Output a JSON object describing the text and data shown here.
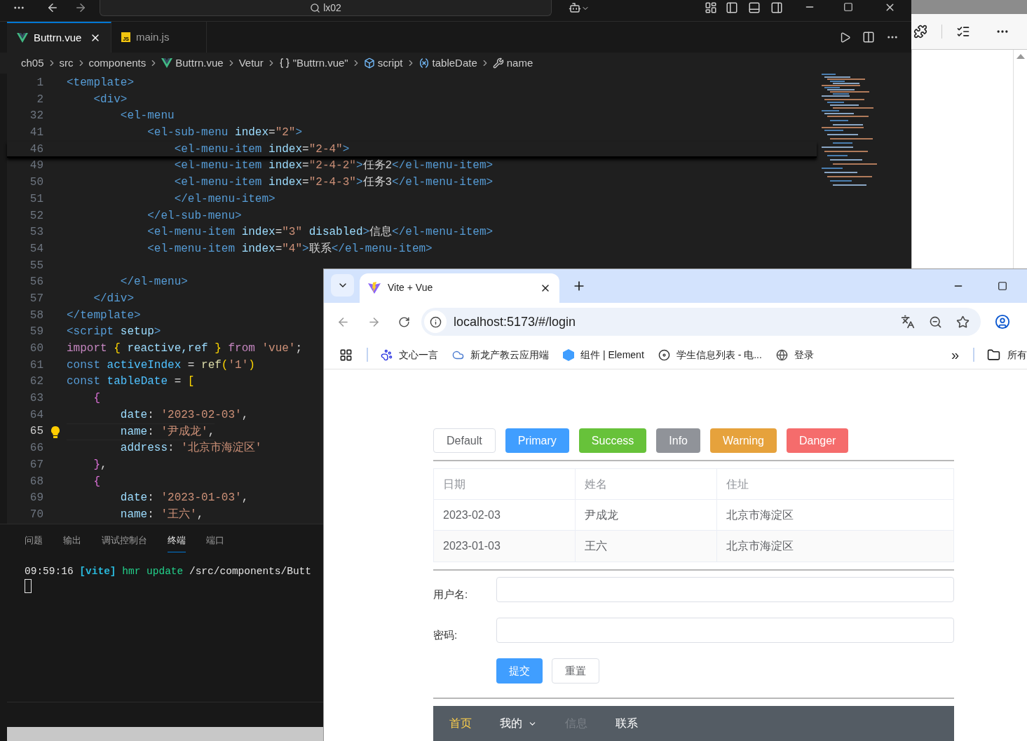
{
  "vscode": {
    "search": "lx02",
    "tabs": [
      {
        "label": "Buttrn.vue",
        "selected": true
      },
      {
        "label": "main.js",
        "badge": "JS",
        "selected": false
      }
    ],
    "breadcrumbs": [
      "ch05",
      "src",
      "components",
      "Buttrn.vue",
      "Vetur",
      "\"Buttrn.vue\"",
      "script",
      "tableDate",
      "name"
    ],
    "lines": [
      {
        "number": "1",
        "current": false,
        "tokens": [
          {
            "kind": "tag",
            "text": "<template>"
          }
        ]
      },
      {
        "number": "2",
        "current": false,
        "tokens": [
          {
            "kind": "tag",
            "text": "    <div>"
          }
        ]
      },
      {
        "number": "32",
        "current": false,
        "tokens": [
          {
            "kind": "tag",
            "text": "        <el-menu"
          }
        ]
      },
      {
        "number": "41",
        "current": false,
        "tokens": [
          {
            "kind": "tag",
            "text": "            <el-sub-menu"
          },
          {
            "kind": "attr",
            "text": " index"
          },
          {
            "kind": "text",
            "text": "="
          },
          {
            "kind": "str",
            "text": "\"2\""
          },
          {
            "kind": "tag",
            "text": ">"
          }
        ]
      },
      {
        "number": "46",
        "current": false,
        "tokens": [
          {
            "kind": "tag",
            "text": "                <el-menu-item"
          },
          {
            "kind": "attr",
            "text": " index"
          },
          {
            "kind": "text",
            "text": "="
          },
          {
            "kind": "str",
            "text": "\"2-4\""
          },
          {
            "kind": "tag",
            "text": ">"
          }
        ]
      },
      {
        "number": "49",
        "current": false,
        "tokens": [
          {
            "kind": "tag",
            "text": "                <el-menu-item"
          },
          {
            "kind": "attr",
            "text": " index"
          },
          {
            "kind": "text",
            "text": "="
          },
          {
            "kind": "str",
            "text": "\"2-4-2\""
          },
          {
            "kind": "tag",
            "text": ">"
          },
          {
            "kind": "text",
            "text": "任务2"
          },
          {
            "kind": "tag",
            "text": "</el-menu-item>"
          }
        ]
      },
      {
        "number": "50",
        "current": false,
        "tokens": [
          {
            "kind": "tag",
            "text": "                <el-menu-item"
          },
          {
            "kind": "attr",
            "text": " index"
          },
          {
            "kind": "text",
            "text": "="
          },
          {
            "kind": "str",
            "text": "\"2-4-3\""
          },
          {
            "kind": "tag",
            "text": ">"
          },
          {
            "kind": "text",
            "text": "任务3"
          },
          {
            "kind": "tag",
            "text": "</el-menu-item>"
          }
        ]
      },
      {
        "number": "51",
        "current": false,
        "tokens": [
          {
            "kind": "tag",
            "text": "                </el-menu-item>"
          }
        ]
      },
      {
        "number": "52",
        "current": false,
        "tokens": [
          {
            "kind": "tag",
            "text": "            </el-sub-menu>"
          }
        ]
      },
      {
        "number": "53",
        "current": false,
        "tokens": [
          {
            "kind": "tag",
            "text": "            <el-menu-item"
          },
          {
            "kind": "attr",
            "text": " index"
          },
          {
            "kind": "text",
            "text": "="
          },
          {
            "kind": "str",
            "text": "\"3\""
          },
          {
            "kind": "attr",
            "text": " disabled"
          },
          {
            "kind": "tag",
            "text": ">"
          },
          {
            "kind": "text",
            "text": "信息"
          },
          {
            "kind": "tag",
            "text": "</el-menu-item>"
          }
        ]
      },
      {
        "number": "54",
        "current": false,
        "tokens": [
          {
            "kind": "tag",
            "text": "            <el-menu-item"
          },
          {
            "kind": "attr",
            "text": " index"
          },
          {
            "kind": "text",
            "text": "="
          },
          {
            "kind": "str",
            "text": "\"4\""
          },
          {
            "kind": "tag",
            "text": ">"
          },
          {
            "kind": "text",
            "text": "联系"
          },
          {
            "kind": "tag",
            "text": "</el-menu-item>"
          }
        ]
      },
      {
        "number": "55",
        "current": false
      },
      {
        "number": "56",
        "current": false,
        "tokens": [
          {
            "kind": "tag",
            "text": "        </el-menu>"
          }
        ]
      },
      {
        "number": "57",
        "current": false,
        "tokens": [
          {
            "kind": "tag",
            "text": "    </div>"
          }
        ]
      },
      {
        "number": "58",
        "current": false,
        "tokens": [
          {
            "kind": "tag",
            "text": "</template>"
          }
        ]
      },
      {
        "number": "59",
        "current": false,
        "tokens": [
          {
            "kind": "tag",
            "text": "<script"
          },
          {
            "kind": "attr",
            "text": " setup"
          },
          {
            "kind": "tag",
            "text": ">"
          }
        ]
      },
      {
        "number": "60",
        "current": false,
        "tokens": [
          {
            "kind": "kw",
            "text": "import"
          },
          {
            "kind": "brace1",
            "text": " {"
          },
          {
            "kind": "attr",
            "text": " reactive,ref"
          },
          {
            "kind": "brace1",
            "text": " }"
          },
          {
            "kind": "kw",
            "text": " from"
          },
          {
            "kind": "str",
            "text": " 'vue'"
          },
          {
            "kind": "text",
            "text": ";"
          }
        ]
      },
      {
        "number": "61",
        "current": false,
        "tokens": [
          {
            "kind": "decl",
            "text": "const"
          },
          {
            "kind": "var",
            "text": " activeIndex"
          },
          {
            "kind": "text",
            "text": " = "
          },
          {
            "kind": "fn",
            "text": "ref"
          },
          {
            "kind": "brace1",
            "text": "("
          },
          {
            "kind": "str",
            "text": "'1'"
          },
          {
            "kind": "brace1",
            "text": ")"
          }
        ]
      },
      {
        "number": "62",
        "current": false,
        "tokens": [
          {
            "kind": "decl",
            "text": "const"
          },
          {
            "kind": "var",
            "text": " tableDate"
          },
          {
            "kind": "text",
            "text": " = "
          },
          {
            "kind": "brace1",
            "text": "["
          }
        ]
      },
      {
        "number": "63",
        "current": false,
        "tokens": [
          {
            "kind": "brace2",
            "text": "    {"
          }
        ]
      },
      {
        "number": "64",
        "current": false,
        "tokens": [
          {
            "kind": "attr",
            "text": "        date"
          },
          {
            "kind": "text",
            "text": ": "
          },
          {
            "kind": "str",
            "text": "'2023-02-03'"
          },
          {
            "kind": "text",
            "text": ","
          }
        ]
      },
      {
        "number": "65",
        "current": true,
        "tokens": [
          {
            "kind": "attr",
            "text": "        name"
          },
          {
            "kind": "text",
            "text": ": "
          },
          {
            "kind": "str",
            "text": "'尹成龙'"
          },
          {
            "kind": "text",
            "text": ","
          }
        ]
      },
      {
        "number": "66",
        "current": false,
        "tokens": [
          {
            "kind": "attr",
            "text": "        address"
          },
          {
            "kind": "text",
            "text": ": "
          },
          {
            "kind": "str",
            "text": "'北京市海淀区'"
          }
        ]
      },
      {
        "number": "67",
        "current": false,
        "tokens": [
          {
            "kind": "brace2",
            "text": "    }"
          },
          {
            "kind": "text",
            "text": ","
          }
        ]
      },
      {
        "number": "68",
        "current": false,
        "tokens": [
          {
            "kind": "brace2",
            "text": "    {"
          }
        ]
      },
      {
        "number": "69",
        "current": false,
        "tokens": [
          {
            "kind": "attr",
            "text": "        date"
          },
          {
            "kind": "text",
            "text": ": "
          },
          {
            "kind": "str",
            "text": "'2023-01-03'"
          },
          {
            "kind": "text",
            "text": ","
          }
        ]
      },
      {
        "number": "70",
        "current": false,
        "tokens": [
          {
            "kind": "attr",
            "text": "        name"
          },
          {
            "kind": "text",
            "text": ": "
          },
          {
            "kind": "str",
            "text": "'王六'"
          },
          {
            "kind": "text",
            "text": ","
          }
        ]
      }
    ],
    "panel_tabs": [
      {
        "label": "问题",
        "selected": false
      },
      {
        "label": "输出",
        "selected": false
      },
      {
        "label": "调试控制台",
        "selected": false
      },
      {
        "label": "终端",
        "selected": true
      },
      {
        "label": "端口",
        "selected": false
      }
    ],
    "terminal": [
      {
        "kind": "time",
        "text": "09:59:16 "
      },
      {
        "kind": "tool",
        "text": "[vite]"
      },
      {
        "kind": "event",
        "text": " hmr update"
      },
      {
        "kind": "path",
        "text": " /src/components/Butt"
      }
    ]
  },
  "browser": {
    "tab": {
      "title": "Vite + Vue"
    },
    "url": "localhost:5173/#/login",
    "bookmarks": [
      "文心一言",
      "新龙产教云应用端",
      "组件 | Element",
      "学生信息列表 - 电...",
      "登录"
    ],
    "bookmarks_more": "»",
    "folder": "所有",
    "buttons": [
      "Default",
      "Primary",
      "Success",
      "Info",
      "Warning",
      "Danger"
    ],
    "table": {
      "columns": [
        "日期",
        "姓名",
        "住址"
      ],
      "rows": [
        [
          "2023-02-03",
          "尹成龙",
          "北京市海淀区"
        ],
        [
          "2023-01-03",
          "王六",
          "北京市海淀区"
        ]
      ]
    },
    "form": {
      "fields": [
        "用户名:",
        "密码:"
      ],
      "buttons": [
        "提交",
        "重置"
      ]
    },
    "menu": [
      {
        "label": "首页",
        "selected": true,
        "disabled": false,
        "kind": "item"
      },
      {
        "label": "我的",
        "selected": false,
        "disabled": false,
        "kind": "submenu"
      },
      {
        "label": "信息",
        "selected": false,
        "disabled": true,
        "kind": "item"
      },
      {
        "label": "联系",
        "selected": false,
        "disabled": false,
        "kind": "item"
      }
    ]
  }
}
